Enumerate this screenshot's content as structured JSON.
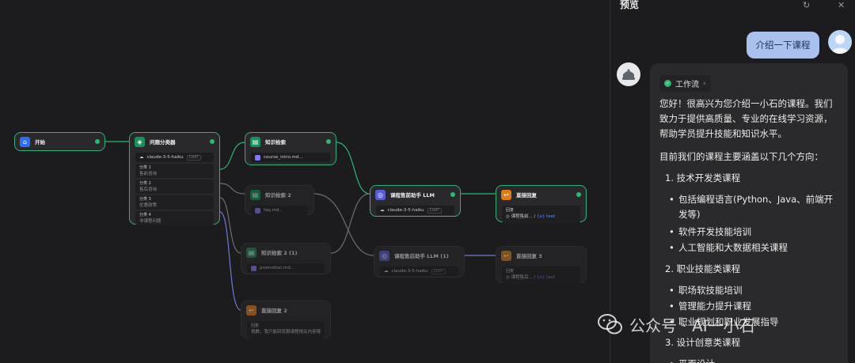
{
  "canvas": {
    "nodes": {
      "start": {
        "title": "开始"
      },
      "classifier": {
        "title": "问题分类器",
        "model": "claude-3-5-haiku",
        "mode": "CHAT",
        "classes": [
          {
            "label": "分类 1",
            "text": "售前咨询"
          },
          {
            "label": "分类 2",
            "text": "售后咨询"
          },
          {
            "label": "分类 3",
            "text": "优惠政策"
          },
          {
            "label": "分类 4",
            "text": "非课程问题"
          }
        ]
      },
      "kr1": {
        "title": "知识检索",
        "file": "course_intro.md..."
      },
      "kr2": {
        "title": "知识检索 2",
        "file": "faq.md..."
      },
      "kr3": {
        "title": "知识检索 2 (1)",
        "file": "promotion.md..."
      },
      "reply2": {
        "title": "直接回复 2",
        "label": "回复",
        "text": "抱歉，我只能回答跟课程相关内容哦！"
      },
      "llm1": {
        "title": "课程售前助手 LLM",
        "model": "claude-3-5-haiku",
        "mode": "CHAT"
      },
      "llm2": {
        "title": "课程售后助手 LLM (1)",
        "model": "claude-3-5-haiku",
        "mode": "CHAT"
      },
      "reply1": {
        "title": "直接回复",
        "label": "回复",
        "ref": "课程售前...",
        "var": "{x} text"
      },
      "reply3": {
        "title": "直接回复 3",
        "label": "回复",
        "ref": "课程售后...",
        "var": "{x} text"
      }
    }
  },
  "preview": {
    "title": "预览",
    "icons": {
      "restart": "restart-icon",
      "close": "close-icon"
    },
    "user_message": "介绍一下课程",
    "workflow_label": "工作流",
    "intro": "您好！很高兴为您介绍一小石的课程。我们致力于提供高质量、专业的在线学习资源，帮助学员提升技能和知识水平。",
    "directions": "目前我们的课程主要涵盖以下几个方向：",
    "sections": [
      {
        "heading": "1. 技术开发类课程",
        "items": [
          "包括编程语言(Python、Java、前端开发等)",
          "软件开发技能培训",
          "人工智能和大数据相关课程"
        ]
      },
      {
        "heading": "2. 职业技能类课程",
        "items": [
          "职场软技能培训",
          "管理能力提升课程",
          "职业规划和职业发展指导"
        ]
      },
      {
        "heading": "3. 设计创意类课程",
        "items": [
          "平面设计"
        ]
      }
    ]
  },
  "watermark": {
    "text": "公众号 · AI一小石"
  },
  "colors": {
    "accent_green": "#2fb574",
    "user_bubble": "#a9c1ef",
    "canvas_bg": "#1c1c1e"
  }
}
